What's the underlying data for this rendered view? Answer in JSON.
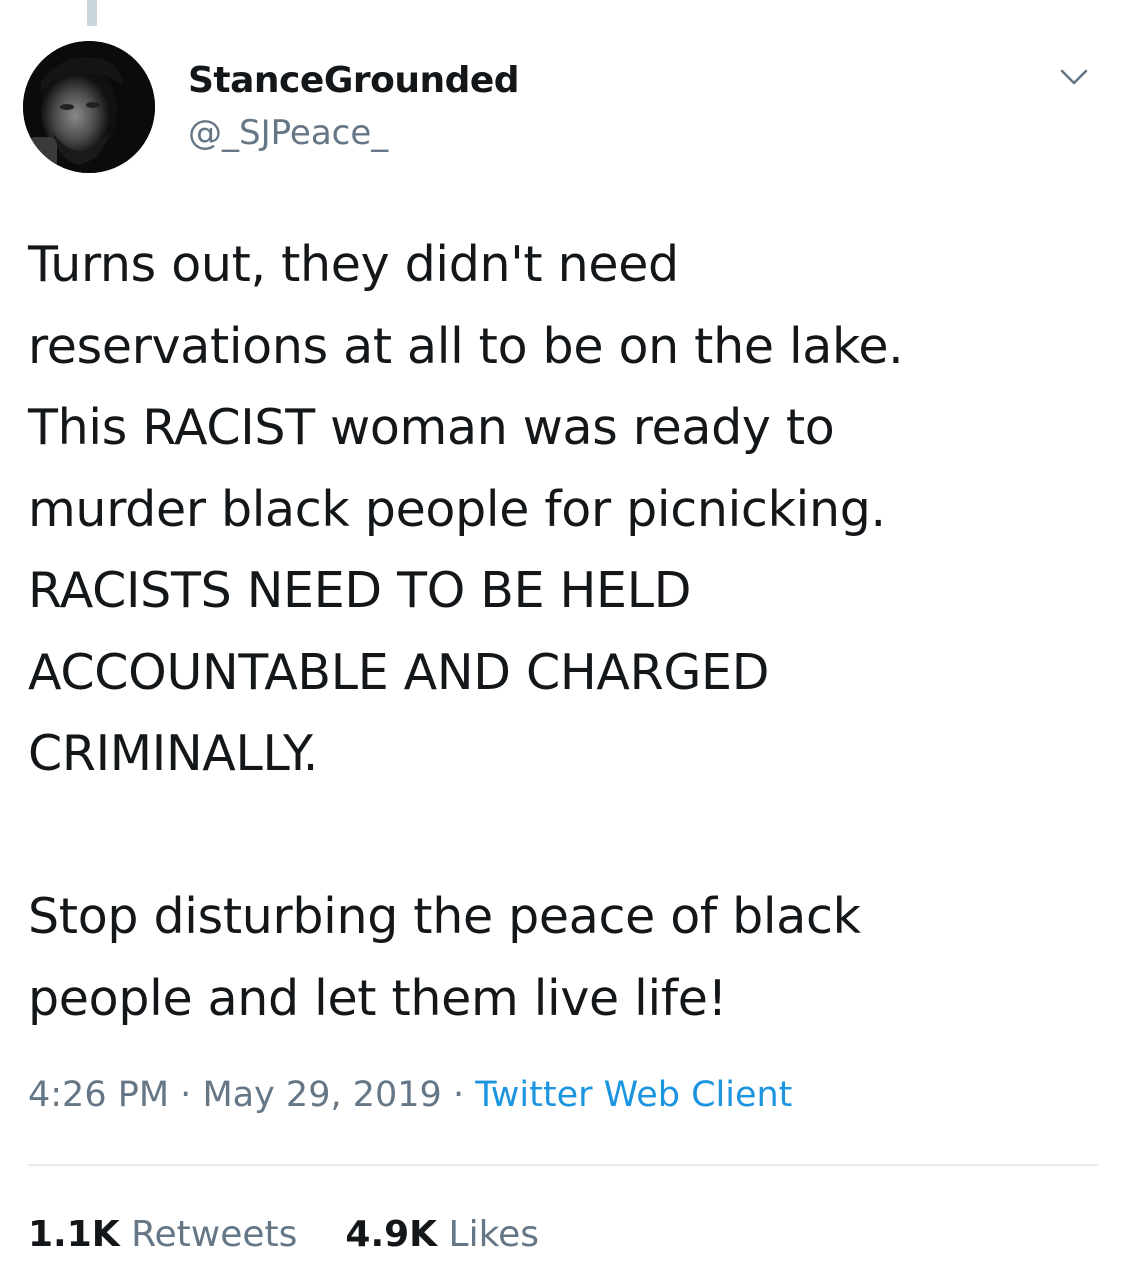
{
  "author": {
    "display_name": "StanceGrounded",
    "handle": "@_SJPeace_"
  },
  "tweet": {
    "text": "Turns out, they didn't need\nreservations at all to be on the lake.\nThis RACIST woman was ready to\nmurder black people for picnicking.\nRACISTS NEED TO BE HELD\nACCOUNTABLE AND CHARGED\nCRIMINALLY.\n\nStop disturbing the peace of black\npeople and let them live life!",
    "time": "4:26 PM",
    "separator": "·",
    "date": "May 29, 2019",
    "source": "Twitter Web Client"
  },
  "stats": {
    "retweets_count": "1.1K",
    "retweets_label": "Retweets",
    "likes_count": "4.9K",
    "likes_label": "Likes"
  },
  "colors": {
    "text": "#14171a",
    "secondary": "#657786",
    "link": "#1b95e0",
    "divider": "#e6ecf0"
  },
  "icons": {
    "menu": "chevron-down-icon"
  }
}
